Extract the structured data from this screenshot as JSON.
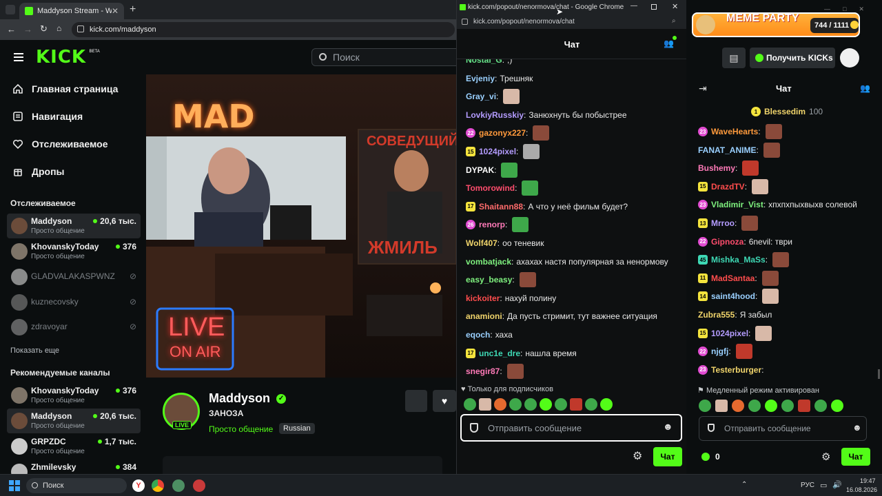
{
  "browser": {
    "tab_title": "Maddyson Stream - Watch",
    "url": "kick.com/maddyson"
  },
  "kick": {
    "logo": "KICK",
    "logo_beta": "BETA",
    "search_placeholder": "Поиск",
    "nav": [
      {
        "label": "Главная страница",
        "icon": "home-icon"
      },
      {
        "label": "Навигация",
        "icon": "browse-icon"
      },
      {
        "label": "Отслеживаемое",
        "icon": "heart-icon"
      },
      {
        "label": "Дропы",
        "icon": "drops-icon"
      }
    ],
    "followed_title": "Отслеживаемое",
    "followed": [
      {
        "name": "Maddyson",
        "category": "Просто общение",
        "viewers": "20,6 тыс.",
        "live": true
      },
      {
        "name": "KhovanskyToday",
        "category": "Просто общение",
        "viewers": "376",
        "live": true
      },
      {
        "name": "GLADVALAKASPWNZ",
        "live": false
      },
      {
        "name": "kuznecovsky",
        "live": false
      },
      {
        "name": "zdravoyar",
        "live": false
      }
    ],
    "show_more": "Показать еще",
    "recommended_title": "Рекомендуемые каналы",
    "recommended": [
      {
        "name": "KhovanskyToday",
        "category": "Просто общение",
        "viewers": "376"
      },
      {
        "name": "Maddyson",
        "category": "Просто общение",
        "viewers": "20,6 тыс."
      },
      {
        "name": "GRPZDC",
        "category": "Просто общение",
        "viewers": "1,7 тыс."
      },
      {
        "name": "Zhmilevsky",
        "category": "",
        "viewers": "384"
      }
    ],
    "video": {
      "neon_top": "MAD",
      "neon_live": "LIVE",
      "neon_on_air": "ON AIR",
      "poster_top": "СОВЕДУЩИЙ",
      "poster_bottom": "ЖМИЛЬ"
    },
    "streamer": {
      "name": "Maddyson",
      "title": "ЗАНОЗА",
      "category": "Просто общение",
      "tag": "Russian",
      "live_badge": "LIVE"
    }
  },
  "popout": {
    "window_title": "kick.com/popout/nenormova/chat - Google Chrome",
    "url": "kick.com/popout/nenormova/chat",
    "header": "Чат",
    "messages": [
      {
        "user": "Nostal_G",
        "color": "#67e58a",
        "badge": "",
        "text": ";)"
      },
      {
        "user": "Evjeniy",
        "color": "#9ad0ff",
        "badge": "",
        "text": "Трешняк"
      },
      {
        "user": "Gray_vi",
        "color": "#9ad0ff",
        "badge": "",
        "text": "",
        "emote": "#d8b9a8"
      },
      {
        "user": "LovkiyRusskiy",
        "color": "#b49cff",
        "badge": "",
        "text": "Занюхнуть бы побыстрее"
      },
      {
        "user": "gazonyx227",
        "color": "#ff9a3c",
        "badge": "22",
        "badgeType": "pink",
        "text": "",
        "emote": "#8a4a3a"
      },
      {
        "user": "1024pixel",
        "color": "#b49cff",
        "badge": "15",
        "badgeType": "yel",
        "text": "",
        "emote": "#aaa"
      },
      {
        "user": "DYPAK",
        "color": "#ffffff",
        "badge": "",
        "text": "",
        "emote": "#3ea84a"
      },
      {
        "user": "Tomorowind",
        "color": "#ff4d6d",
        "badge": "",
        "text": "",
        "emote": "#3ea84a"
      },
      {
        "user": "Shaitann88",
        "color": "#ff6b6b",
        "badge": "17",
        "badgeType": "yel",
        "text": "А что у неё фильм будет?"
      },
      {
        "user": "renorp",
        "color": "#ff7ab8",
        "badge": "26",
        "badgeType": "pink",
        "text": "",
        "emote": "#3ea84a"
      },
      {
        "user": "Wolf407",
        "color": "#f0d46b",
        "badge": "",
        "text": "оо теневик"
      },
      {
        "user": "vombatjack",
        "color": "#7ef07e",
        "badge": "",
        "text": "ахахах настя популярная за ненормову"
      },
      {
        "user": "easy_beasy",
        "color": "#7ef07e",
        "badge": "",
        "text": "",
        "emote": "#8a4a3a"
      },
      {
        "user": "kickoiter",
        "color": "#ff4d4d",
        "badge": "",
        "text": "нахуй полину"
      },
      {
        "user": "anamioni",
        "color": "#f0d46b",
        "badge": "",
        "text": "Да пусть стримит, тут важнее ситуация"
      },
      {
        "user": "eqoch",
        "color": "#9ad0ff",
        "badge": "",
        "text": "хаха"
      },
      {
        "user": "unc1e_dre",
        "color": "#3ed9b5",
        "badge": "17",
        "badgeType": "yel",
        "text": "нашла время"
      },
      {
        "user": "snegir87",
        "color": "#ff7ab8",
        "badge": "",
        "text": "",
        "emote": "#8a4a3a"
      }
    ],
    "subs_only": "Только для подписчиков",
    "input_placeholder": "Отправить сообщение",
    "send_label": "Чат"
  },
  "right": {
    "meme_party": "MEME PARTY",
    "points": "744 / 1111",
    "get_kicks": "Получить KICKs",
    "header": "Чат",
    "pinned_user": "Blessedim",
    "pinned_count": "100",
    "messages": [
      {
        "user": "WaveHearts",
        "color": "#ff9a3c",
        "badge": "23",
        "badgeType": "pink",
        "text": "",
        "emote": "#8a4a3a"
      },
      {
        "user": "FANAT_ANIME",
        "color": "#9ad0ff",
        "badge": "",
        "text": "",
        "emote": "#8a4a3a"
      },
      {
        "user": "Bushemy",
        "color": "#ff7ab8",
        "badge": "",
        "text": "",
        "emote": "#c0392b"
      },
      {
        "user": "DrazdTV",
        "color": "#ff4d4d",
        "badge": "15",
        "badgeType": "yel",
        "text": "",
        "emote": "#d8b9a8"
      },
      {
        "user": "Vladimir_Vist",
        "color": "#7ef07e",
        "badge": "23",
        "badgeType": "pink",
        "text": "хпхпхпыхвыхв солевой"
      },
      {
        "user": "Mrroo",
        "color": "#b49cff",
        "badge": "13",
        "badgeType": "yel",
        "text": "",
        "emote": "#8a4a3a"
      },
      {
        "user": "Gipnoza",
        "color": "#ff4d6d",
        "badge": "22",
        "badgeType": "pink",
        "text": "6nevil: тври"
      },
      {
        "user": "Mishka_MaSs",
        "color": "#3ed9b5",
        "badge": "45",
        "badgeType": "teal",
        "text": "",
        "emote": "#8a4a3a"
      },
      {
        "user": "MadSantaa",
        "color": "#ff4d4d",
        "badge": "11",
        "badgeType": "yel",
        "text": "",
        "emote": "#8a4a3a"
      },
      {
        "user": "saint4hood",
        "color": "#9ad0ff",
        "badge": "14",
        "badgeType": "yel",
        "text": "",
        "emote": "#d8b9a8"
      },
      {
        "user": "Zubra555",
        "color": "#f0d46b",
        "badge": "",
        "text": "Я забыл"
      },
      {
        "user": "1024pixel",
        "color": "#b49cff",
        "badge": "15",
        "badgeType": "yel",
        "text": "",
        "emote": "#d8b9a8"
      },
      {
        "user": "njgfj",
        "color": "#9ad0ff",
        "badge": "22",
        "badgeType": "pink",
        "text": "",
        "emote": "#c0392b"
      },
      {
        "user": "Testerburger",
        "color": "#f0d46b",
        "badge": "23",
        "badgeType": "pink",
        "text": ""
      }
    ],
    "slow_mode": "Медленный режим активирован",
    "input_placeholder": "Отправить сообщение",
    "kicks_count": "0",
    "send_label": "Чат"
  },
  "taskbar": {
    "search": "Поиск",
    "lang": "РУС",
    "time": "19:47",
    "date": "16.08.2026"
  },
  "colors": {
    "kick_green": "#53fc18",
    "bg": "#0b0e0f",
    "panel": "#0e1011"
  }
}
